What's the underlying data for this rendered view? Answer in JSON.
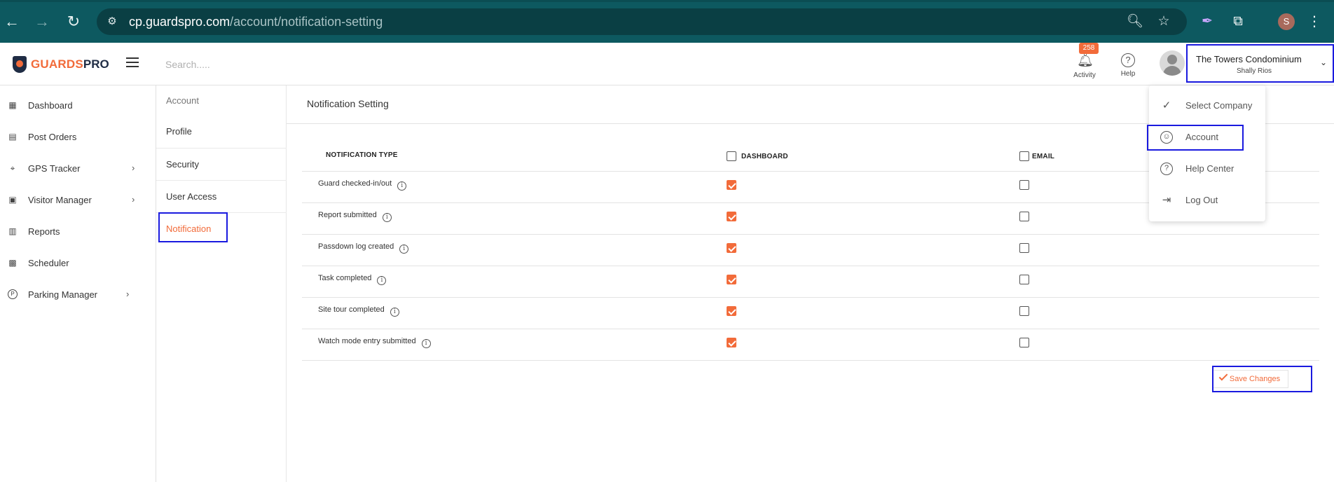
{
  "browser": {
    "back_icon": "←",
    "forward_icon": "→",
    "reload_icon": "↻",
    "url_host": "cp.guardspro.com",
    "url_path": "/account/notification-setting",
    "profile_initial": "S"
  },
  "header": {
    "logo_guards": "GUARDS",
    "logo_pro": "PRO",
    "search_placeholder": "Search.....",
    "activity_label": "Activity",
    "activity_count": "258",
    "help_label": "Help",
    "company_name": "The Towers Condominium",
    "user_name": "Shally Rios"
  },
  "sidebar": {
    "items": [
      {
        "label": "Dashboard",
        "icon": "dashboard-icon",
        "has_chevron": false
      },
      {
        "label": "Post Orders",
        "icon": "post-orders-icon",
        "has_chevron": false
      },
      {
        "label": "GPS Tracker",
        "icon": "map-pin-icon",
        "has_chevron": true
      },
      {
        "label": "Visitor Manager",
        "icon": "visitor-icon",
        "has_chevron": true
      },
      {
        "label": "Reports",
        "icon": "reports-icon",
        "has_chevron": false
      },
      {
        "label": "Scheduler",
        "icon": "calendar-icon",
        "has_chevron": false
      },
      {
        "label": "Parking Manager",
        "icon": "parking-icon",
        "has_chevron": true
      }
    ]
  },
  "account_nav": {
    "title": "Account",
    "items": [
      {
        "label": "Profile",
        "active": false
      },
      {
        "label": "Security",
        "active": false
      },
      {
        "label": "User Access",
        "active": false
      },
      {
        "label": "Notification",
        "active": true
      }
    ]
  },
  "notification": {
    "title": "Notification Setting",
    "columns": [
      "NOTIFICATION TYPE",
      "DASHBOARD",
      "EMAIL"
    ],
    "rows": [
      {
        "label": "Guard checked-in/out",
        "dashboard": true,
        "email": false
      },
      {
        "label": "Report submitted",
        "dashboard": true,
        "email": false
      },
      {
        "label": "Passdown log created",
        "dashboard": true,
        "email": false
      },
      {
        "label": "Task completed",
        "dashboard": true,
        "email": false
      },
      {
        "label": "Site tour completed",
        "dashboard": true,
        "email": false
      },
      {
        "label": "Watch mode entry submitted",
        "dashboard": true,
        "email": false
      }
    ],
    "save_label": "Save Changes"
  },
  "dropdown": {
    "items": [
      {
        "label": "Select Company",
        "icon": "check-icon"
      },
      {
        "label": "Account",
        "icon": "user-circle-icon"
      },
      {
        "label": "Help Center",
        "icon": "help-circle-icon"
      },
      {
        "label": "Log Out",
        "icon": "logout-icon"
      }
    ]
  },
  "colors": {
    "accent": "#f26b3a",
    "browser_bar": "#0d5960",
    "highlight": "#1a1adf"
  }
}
